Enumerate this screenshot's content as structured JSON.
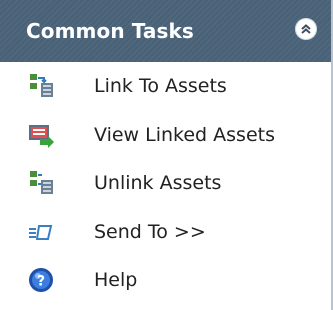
{
  "panel": {
    "title": "Common Tasks",
    "collapse_icon": "chevron-double-up-icon",
    "colors": {
      "header_bg": "#4a6278",
      "header_text": "#ffffff",
      "border": "#b9c3cf"
    }
  },
  "tasks": [
    {
      "label": "Link To Assets",
      "icon": "link-assets-icon"
    },
    {
      "label": "View Linked Assets",
      "icon": "view-linked-assets-icon"
    },
    {
      "label": "Unlink Assets",
      "icon": "unlink-assets-icon"
    },
    {
      "label": "Send To >>",
      "icon": "send-to-icon"
    },
    {
      "label": "Help",
      "icon": "help-icon"
    }
  ]
}
